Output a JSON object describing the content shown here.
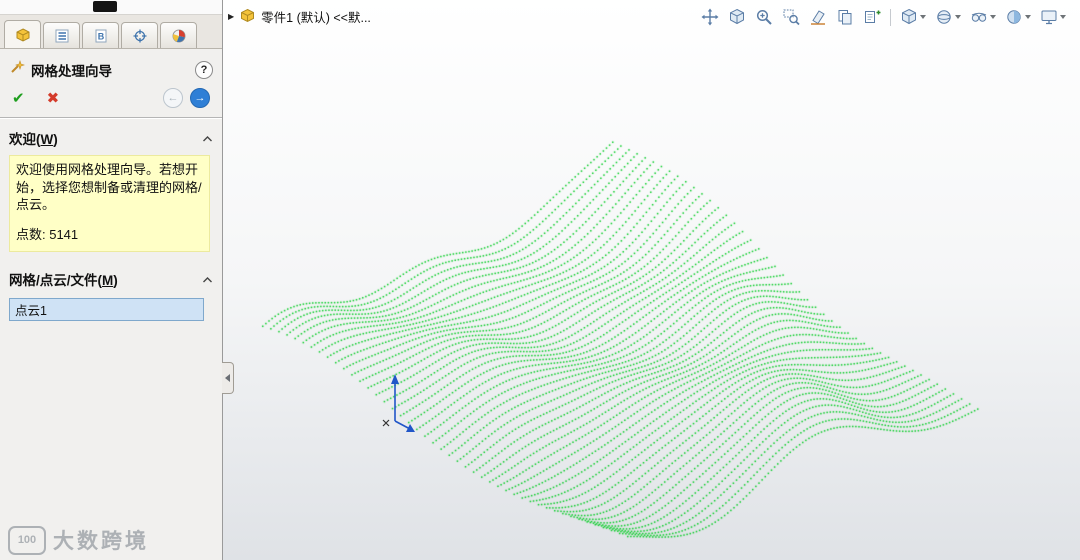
{
  "panel": {
    "tabs": [
      {
        "name": "propertymanager",
        "type": "swbadge",
        "active": true
      },
      {
        "name": "featuremanager",
        "type": "list"
      },
      {
        "name": "configurationmanager",
        "type": "clipb",
        "label": "B"
      },
      {
        "name": "dimxpertmanager",
        "type": "target"
      },
      {
        "name": "displaymanager",
        "type": "pie"
      }
    ],
    "title": "网格处理向导",
    "help_glyph": "?",
    "ok_glyph": "✔",
    "cancel_glyph": "✖",
    "back_glyph": "←",
    "forward_glyph": "→",
    "sections": {
      "welcome": {
        "prefix": "欢迎(",
        "key": "W",
        "suffix": ")",
        "message": "欢迎使用网格处理向导。若想开始，选择您想制备或清理的网格/点云。",
        "points": "点数: 5141"
      },
      "mesh": {
        "prefix": "网格/点云/文件(",
        "key": "M",
        "suffix": ")",
        "selection": "点云1"
      }
    }
  },
  "viewport": {
    "expand_glyph": "▶",
    "breadcrumb": "零件1 (默认) <<默...",
    "toolbar": [
      {
        "name": "pan-3d",
        "type": "move3d"
      },
      {
        "name": "view-cube",
        "type": "cube"
      },
      {
        "name": "zoom-to-fit",
        "type": "zoomin"
      },
      {
        "name": "zoom-to-area",
        "type": "zoomarea"
      },
      {
        "name": "section-view",
        "type": "section"
      },
      {
        "name": "previous-view",
        "type": "pages"
      },
      {
        "name": "view-palette",
        "type": "pagesplus"
      },
      {
        "type": "sep"
      },
      {
        "name": "view-orientation",
        "type": "cube",
        "caret": true
      },
      {
        "name": "display-style",
        "type": "sphere",
        "caret": true
      },
      {
        "name": "hide-show-items",
        "type": "eye",
        "caret": true
      },
      {
        "name": "edit-appearance",
        "type": "ball",
        "caret": true
      },
      {
        "name": "view-settings",
        "type": "monitor",
        "caret": true
      }
    ]
  },
  "watermark": {
    "badge": "100",
    "text": "大数跨境"
  },
  "colors": {
    "point_cloud": "#00cc22",
    "triad_blue": "#2156c8",
    "accent_blue": "#2f7fd6",
    "message_bg": "#ffffc6"
  }
}
